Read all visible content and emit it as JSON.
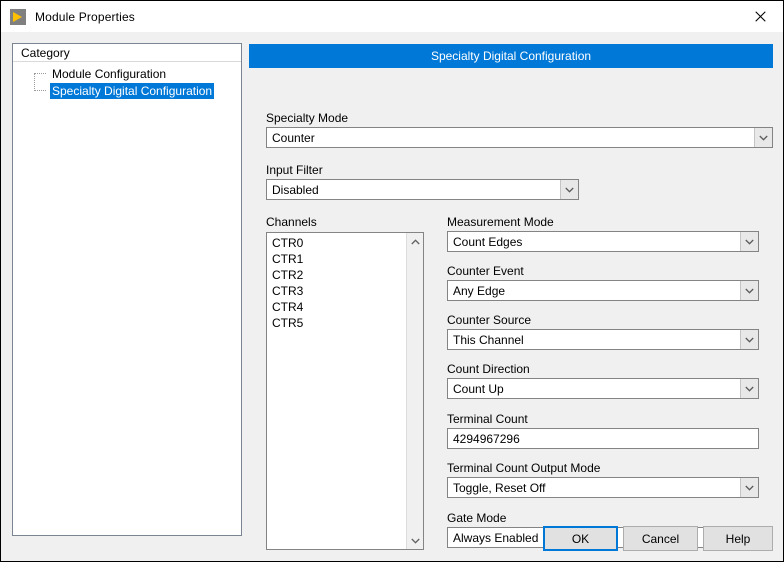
{
  "window": {
    "title": "Module Properties",
    "app_icon": "labview-run-icon",
    "close_icon": "close-icon",
    "accent_color": "#0078d7",
    "body_background": "#f0f0f0"
  },
  "category_panel": {
    "header": "Category",
    "items": [
      {
        "label": "Module Configuration",
        "selected": false
      },
      {
        "label": "Specialty Digital Configuration",
        "selected": true
      }
    ]
  },
  "pane": {
    "header_title": "Specialty Digital Configuration",
    "specialty_mode": {
      "label": "Specialty Mode",
      "value": "Counter",
      "arrow_icon": "chevron-down-icon"
    },
    "input_filter": {
      "label": "Input Filter",
      "value": "Disabled",
      "arrow_icon": "chevron-down-icon"
    },
    "channels": {
      "label": "Channels",
      "items": [
        {
          "label": "CTR0",
          "selected": true
        },
        {
          "label": "CTR1",
          "selected": false
        },
        {
          "label": "CTR2",
          "selected": false
        },
        {
          "label": "CTR3",
          "selected": false
        },
        {
          "label": "CTR4",
          "selected": false
        },
        {
          "label": "CTR5",
          "selected": false
        }
      ],
      "scroll_up_icon": "chevron-up-icon",
      "scroll_down_icon": "chevron-down-icon"
    },
    "measurement_mode": {
      "label": "Measurement Mode",
      "value": "Count Edges",
      "arrow_icon": "chevron-down-icon"
    },
    "counter_event": {
      "label": "Counter Event",
      "value": "Any Edge",
      "arrow_icon": "chevron-down-icon"
    },
    "counter_source": {
      "label": "Counter Source",
      "value": "This Channel",
      "arrow_icon": "chevron-down-icon"
    },
    "count_direction": {
      "label": "Count Direction",
      "value": "Count Up",
      "arrow_icon": "chevron-down-icon"
    },
    "terminal_count": {
      "label": "Terminal Count",
      "value": "4294967296"
    },
    "terminal_count_output_mode": {
      "label": "Terminal Count Output Mode",
      "value": "Toggle, Reset Off",
      "arrow_icon": "chevron-down-icon"
    },
    "gate_mode": {
      "label": "Gate Mode",
      "value": "Always Enabled",
      "arrow_icon": "chevron-down-icon"
    }
  },
  "footer": {
    "ok_label": "OK",
    "cancel_label": "Cancel",
    "help_label": "Help"
  }
}
